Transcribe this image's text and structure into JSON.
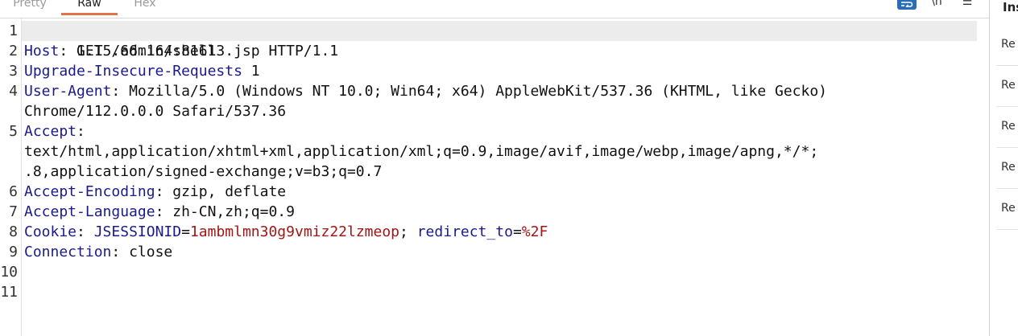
{
  "tabs": {
    "pretty": "Pretty",
    "raw": "Raw",
    "hex": "Hex",
    "active": "Raw"
  },
  "toolbar": {
    "wrap_icon": "wrap-lines-icon",
    "newline_icon": "newline-icon",
    "newline_glyph": "\\n",
    "menu_icon": "hamburger-menu-icon",
    "menu_glyph": "☰"
  },
  "colors": {
    "accent_tab": "#e0734a",
    "header_name": "#1a1a8c",
    "cookie_value": "#a31515",
    "active_button": "#2b6db5"
  },
  "request": {
    "line_numbers": [
      "1",
      "2",
      "3",
      "4",
      "5",
      "6",
      "7",
      "8",
      "9",
      "10",
      "11"
    ],
    "request_line": "GET /admin/shell3.jsp HTTP/1.1",
    "host": {
      "name": "Host",
      "sep": ": ",
      "value": "1.15.66.164:8161"
    },
    "upgrade": {
      "name": "Upgrade-Insecure-Requests",
      "sep": " ",
      "value": "1"
    },
    "user_agent": {
      "name": "User-Agent",
      "sep": ": ",
      "value_line1": "Mozilla/5.0 (Windows NT 10.0; Win64; x64) AppleWebKit/537.36 (KHTML, like Gecko)",
      "value_line2": "Chrome/112.0.0.0 Safari/537.36"
    },
    "accept": {
      "name": "Accept",
      "sep": ":",
      "value_line1": "text/html,application/xhtml+xml,application/xml;q=0.9,image/avif,image/webp,image/apng,*/*;",
      "value_line2": ".8,application/signed-exchange;v=b3;q=0.7"
    },
    "accept_encoding": {
      "name": "Accept-Encoding",
      "sep": ": ",
      "value": "gzip, deflate"
    },
    "accept_language": {
      "name": "Accept-Language",
      "sep": ": ",
      "value": "zh-CN,zh;q=0.9"
    },
    "cookie": {
      "name": "Cookie",
      "sep": ": ",
      "c1_name": "JSESSIONID",
      "eq": "=",
      "c1_value": "1ambmlmn30g9vmiz22lzmeop",
      "delim": "; ",
      "c2_name": "redirect_to",
      "c2_value": "%2F"
    },
    "connection": {
      "name": "Connection",
      "sep": ": ",
      "value": "close"
    }
  },
  "inspector": {
    "title": "Ins",
    "rows": [
      "Re",
      "Re",
      "Re",
      "Re",
      "Re"
    ]
  }
}
